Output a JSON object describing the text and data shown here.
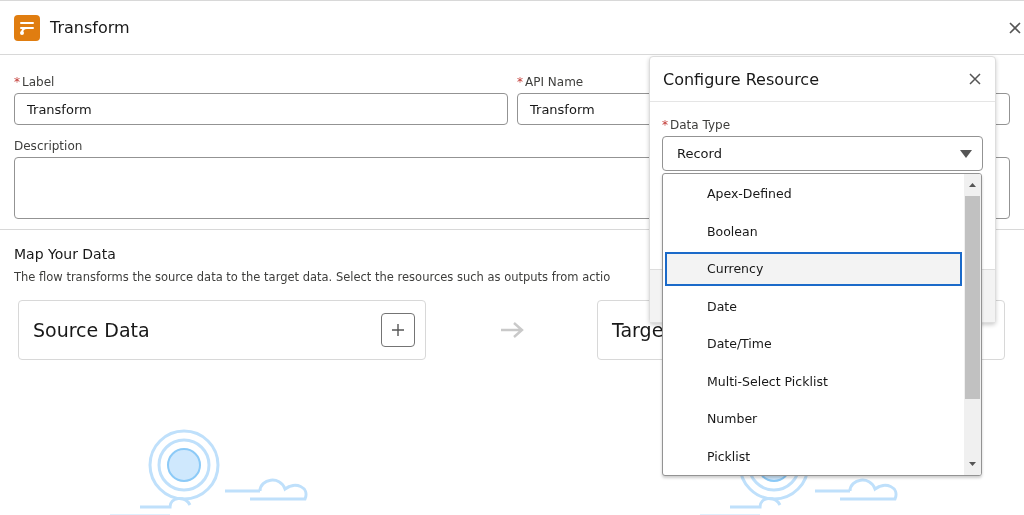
{
  "header": {
    "title": "Transform"
  },
  "fields": [
    {
      "required_mark": "*",
      "label": "Label",
      "value": "Transform"
    },
    {
      "required_mark": "*",
      "label": "API Name",
      "value": "Transform"
    }
  ],
  "description": {
    "label": "Description"
  },
  "map_section": {
    "title": "Map Your Data",
    "text": "The flow transforms the source data to the target data. Select the resources such as outputs from actio",
    "source_card": {
      "title": "Source Data"
    },
    "target_card": {
      "title": "Targe"
    }
  },
  "modal": {
    "title": "Configure Resource",
    "data_type": {
      "required_mark": "*",
      "label": "Data Type",
      "value": "Record"
    },
    "options": [
      {
        "label": "Apex-Defined",
        "selected": false
      },
      {
        "label": "Boolean",
        "selected": false
      },
      {
        "label": "Currency",
        "selected": true
      },
      {
        "label": "Date",
        "selected": false
      },
      {
        "label": "Date/Time",
        "selected": false
      },
      {
        "label": "Multi-Select Picklist",
        "selected": false
      },
      {
        "label": "Number",
        "selected": false
      },
      {
        "label": "Picklist",
        "selected": false
      }
    ]
  }
}
